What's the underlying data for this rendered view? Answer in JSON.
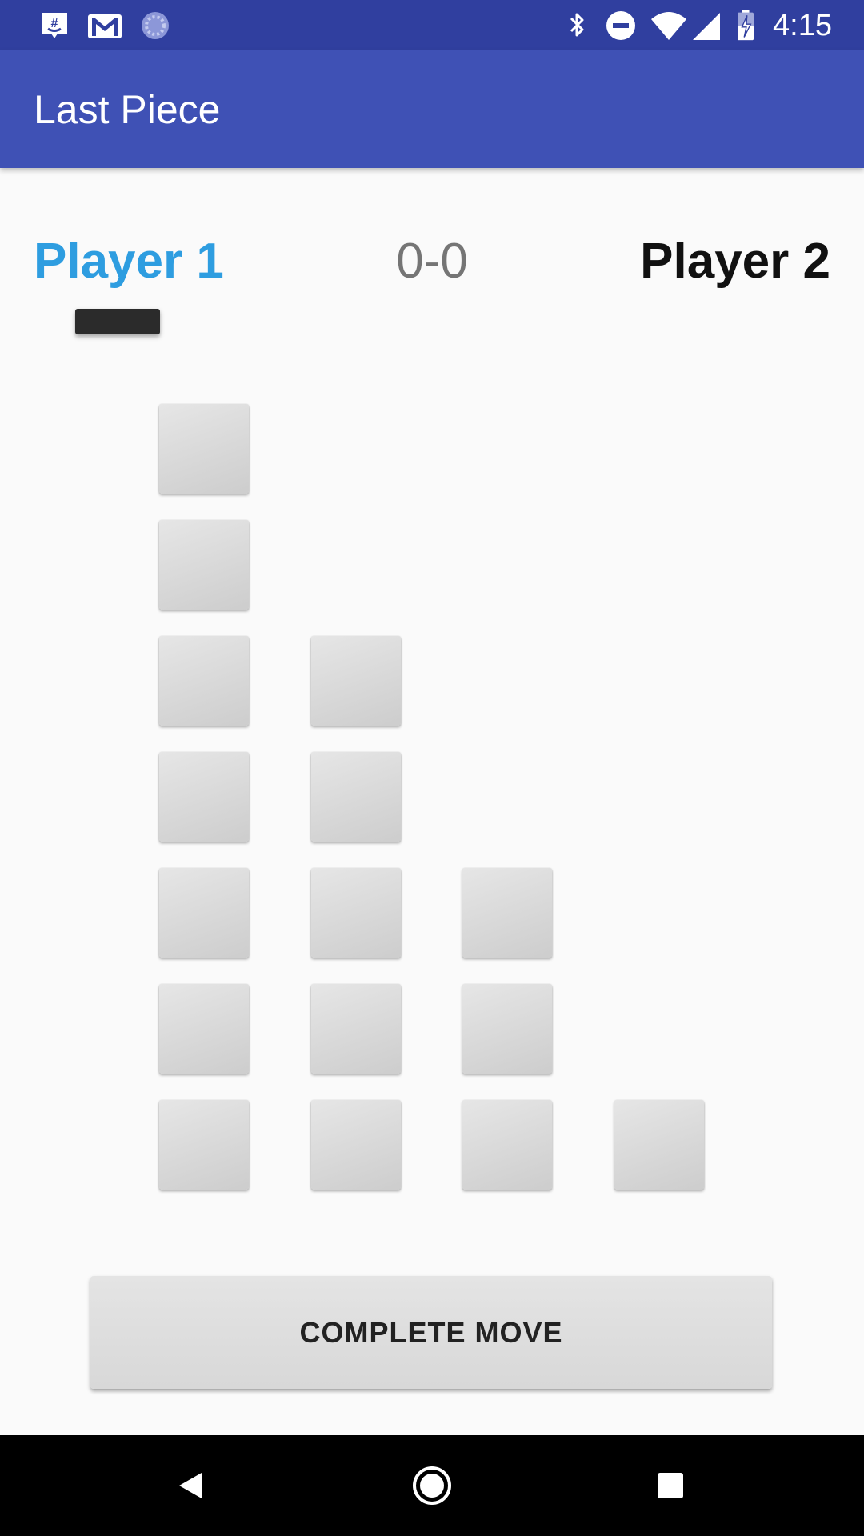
{
  "status_bar": {
    "time": "4:15",
    "left_icons": [
      "chat-notification-icon",
      "gmail-icon",
      "sync-progress-icon"
    ],
    "right_icons": [
      "bluetooth-icon",
      "do-not-disturb-icon",
      "wifi-icon",
      "cellular-signal-icon",
      "battery-charging-icon"
    ],
    "color": "#303f9f"
  },
  "app_bar": {
    "title": "Last Piece",
    "color": "#3f51b5"
  },
  "game": {
    "player1_label": "Player 1",
    "player1_color": "#2e9de0",
    "score": "0-0",
    "player2_label": "Player 2",
    "current_turn": "Player 1",
    "columns": [
      {
        "pieces": 7
      },
      {
        "pieces": 5
      },
      {
        "pieces": 3
      },
      {
        "pieces": 1
      }
    ]
  },
  "actions": {
    "complete_move_label": "COMPLETE MOVE"
  },
  "nav_bar": {
    "buttons": [
      "back-icon",
      "home-icon",
      "recents-icon"
    ]
  }
}
